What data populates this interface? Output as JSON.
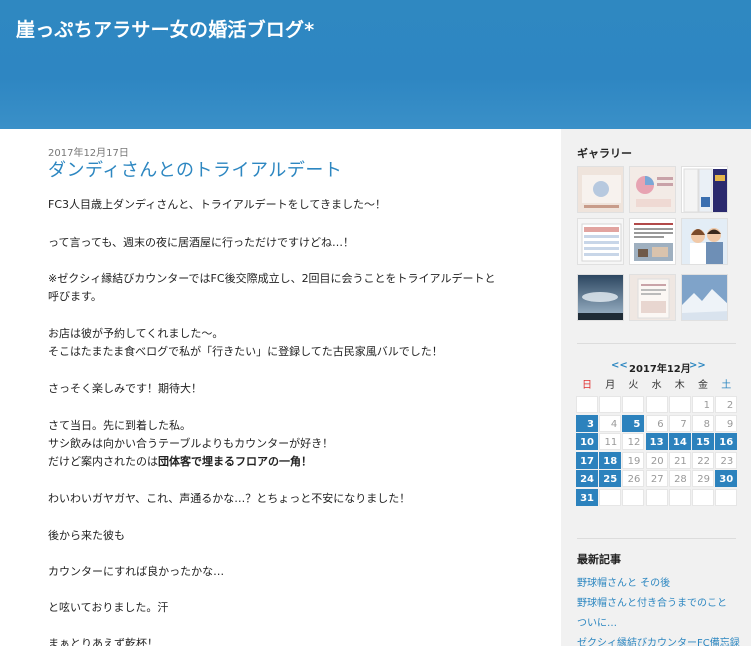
{
  "header": {
    "title": "崖っぷちアラサー女の婚活ブログ*"
  },
  "post": {
    "date": "2017年12月17日",
    "title": "ダンディさんとのトライアルデート",
    "lines": [
      "FC3人目歳上ダンディさんと、トライアルデートをしてきました〜！",
      "って言っても、週末の夜に居酒屋に行っただけですけどね…！",
      "※ゼクシィ縁結びカウンターではFC後交際成立し、2回目に会うことをトライアルデートと",
      "呼びます。",
      "お店は彼が予約してくれました〜。",
      "そこはたまたま食べログで私が「行きたい」に登録してた古民家風バルでした！",
      "さっそく楽しみです！期待大！",
      "さて当日。先に到着した私。",
      "サシ飲みは向かい合うテーブルよりもカウンターが好き！",
      "だけど案内されたのは",
      "団体客で埋まるフロアの一角！",
      "わいわいガヤガヤ、これ、声通るかな…？とちょっと不安になりました！",
      "後から来た彼も",
      "カウンターにすれば良かったかな…",
      "と呟いておりました。汗",
      "まぁとりあえず乾杯！"
    ]
  },
  "sidebar": {
    "gallery_title": "ギャラリー",
    "gallery_items": [
      {
        "icon": "chart-thumbnail-icon"
      },
      {
        "icon": "pie-chart-thumbnail-icon"
      },
      {
        "icon": "book-covers-thumbnail-icon"
      },
      {
        "icon": "table-doc-thumbnail-icon"
      },
      {
        "icon": "text-doc-thumbnail-icon"
      },
      {
        "icon": "couple-photo-thumbnail-icon"
      },
      {
        "icon": "sky-photo-thumbnail-icon"
      },
      {
        "icon": "document-photo-thumbnail-icon"
      },
      {
        "icon": "snow-mountain-thumbnail-icon"
      }
    ],
    "calendar": {
      "prev": "<<",
      "month": "2017年12月",
      "next": ">>",
      "weekdays": [
        "日",
        "月",
        "火",
        "水",
        "木",
        "金",
        "土"
      ],
      "weekday_colors": [
        "#e03030",
        "#333333",
        "#333333",
        "#333333",
        "#333333",
        "#333333",
        "#2d87c1"
      ],
      "weeks": [
        [
          "",
          "",
          "",
          "",
          "",
          "1",
          "2"
        ],
        [
          "3",
          "4",
          "5",
          "6",
          "7",
          "8",
          "9"
        ],
        [
          "10",
          "11",
          "12",
          "13",
          "14",
          "15",
          "16"
        ],
        [
          "17",
          "18",
          "19",
          "20",
          "21",
          "22",
          "23"
        ],
        [
          "24",
          "25",
          "26",
          "27",
          "28",
          "29",
          "30"
        ],
        [
          "31",
          "",
          "",
          "",
          "",
          "",
          ""
        ]
      ],
      "post_days": [
        "3",
        "5",
        "10",
        "13",
        "14",
        "15",
        "16",
        "17",
        "18",
        "24",
        "25",
        "30",
        "31"
      ]
    },
    "recent_title": "最新記事",
    "recent_posts": [
      "野球帽さんと その後",
      "野球帽さんと付き合うまでのこと",
      "ついに…",
      "ゼクシィ縁結びカウンターFC備忘録"
    ]
  }
}
